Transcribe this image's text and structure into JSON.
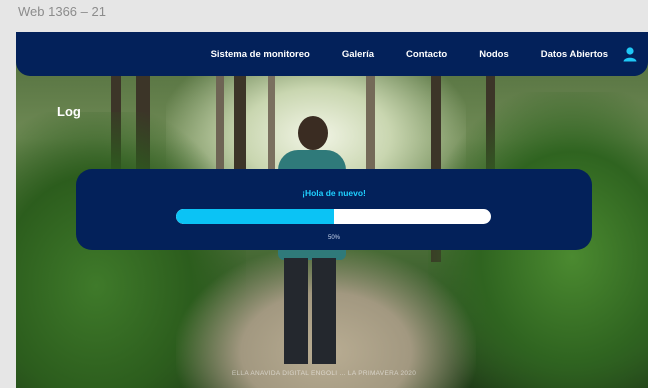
{
  "artboard": {
    "label": "Web 1366 – 21"
  },
  "nav": {
    "items": [
      {
        "label": "Sistema de monitoreo"
      },
      {
        "label": "Galería"
      },
      {
        "label": "Contacto"
      },
      {
        "label": "Nodos"
      },
      {
        "label": "Datos Abiertos"
      }
    ],
    "user_icon": "user-icon",
    "icon_color": "#1fc8f5"
  },
  "page": {
    "heading": "Log"
  },
  "modal": {
    "title": "¡Hola de nuevo!",
    "progress_percent": 50,
    "progress_text": "50%"
  },
  "footer": {
    "text": "ELLA ANAVIDA DIGITAL ENGOLI ... LA PRIMAVERA 2020"
  },
  "colors": {
    "navy": "#03215a",
    "accent": "#1fd0ff",
    "progress_fill": "#0bc3f5",
    "progress_track": "#ffffff"
  }
}
